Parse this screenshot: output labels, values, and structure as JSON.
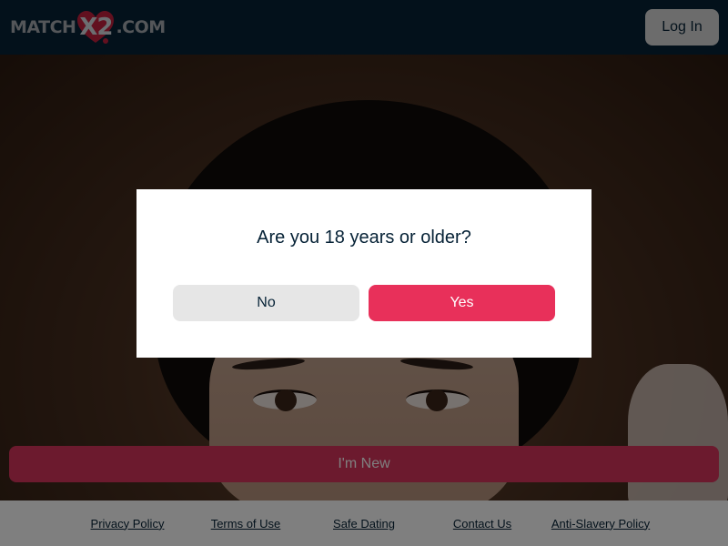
{
  "header": {
    "logo": {
      "left": "MATCH",
      "middle": "X2",
      "right": ".COM"
    },
    "login_label": "Log In"
  },
  "hero": {
    "new_button_label": "I'm New"
  },
  "modal": {
    "question": "Are you 18 years or older?",
    "no_label": "No",
    "yes_label": "Yes"
  },
  "footer": {
    "links": [
      "Privacy Policy",
      "Terms of Use",
      "Safe Dating",
      "Contact Us",
      "Anti-Slavery Policy"
    ]
  },
  "colors": {
    "header_bg": "#062236",
    "accent": "#e8305a",
    "secondary_button": "#e6e6e6"
  }
}
